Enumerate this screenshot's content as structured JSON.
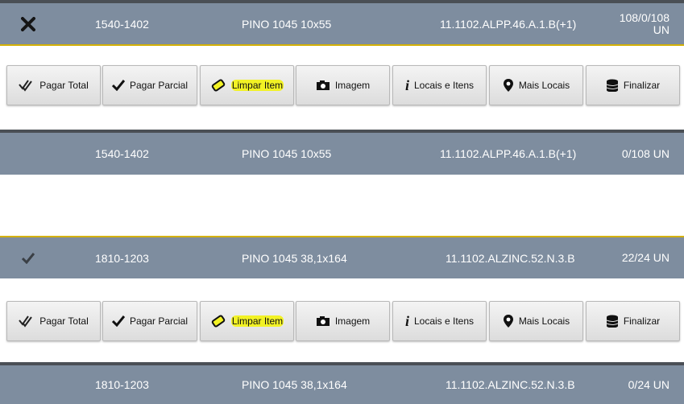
{
  "rows": [
    {
      "status": "x-icon",
      "code": "1540-1402",
      "name": "PINO 1045 10x55",
      "location": "11.1102.ALPP.46.A.1.B(+1)",
      "qty_line1": "108/0/108",
      "qty_line2": "UN"
    },
    {
      "code": "1540-1402",
      "name": "PINO 1045 10x55",
      "location": "11.1102.ALPP.46.A.1.B(+1)",
      "qty": "0/108 UN"
    },
    {
      "status": "check-icon",
      "code": "1810-1203",
      "name": "PINO 1045 38,1x164",
      "location": "11.1102.ALZINC.52.N.3.B",
      "qty": "22/24 UN"
    },
    {
      "code": "1810-1203",
      "name": "PINO 1045 38,1x164",
      "location": "11.1102.ALZINC.52.N.3.B",
      "qty": "0/24 UN"
    }
  ],
  "buttons": {
    "pagar_total": "Pagar Total",
    "pagar_parcial": "Pagar Parcial",
    "limpar_item": "Limpar Item",
    "imagem": "Imagem",
    "locais_itens": "Locais e Itens",
    "mais_locais": "Mais Locais",
    "finalizar": "Finalizar"
  },
  "colors": {
    "row_bg": "#7e8d9f",
    "highlight": "#f2f225",
    "accent_line": "#d4b106"
  }
}
